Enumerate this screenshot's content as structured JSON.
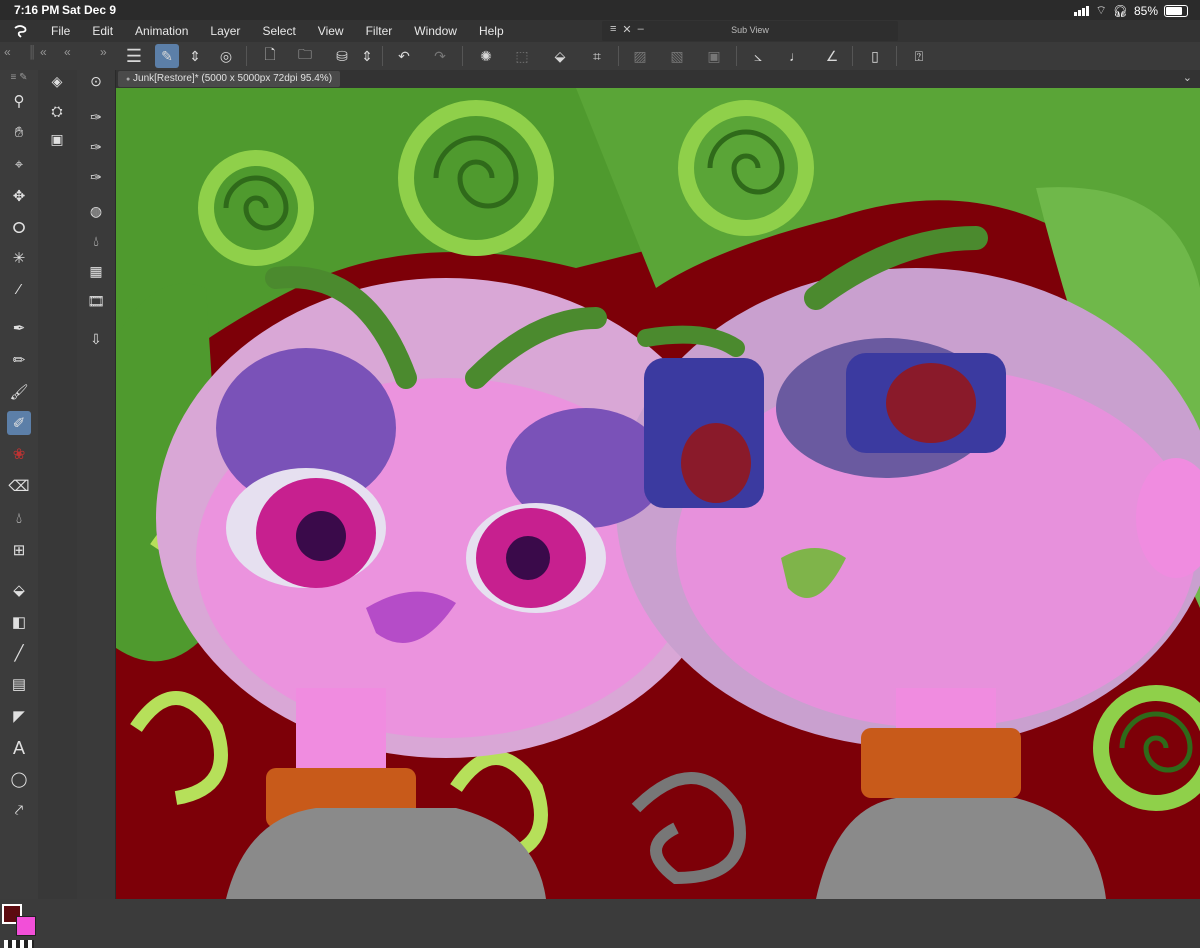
{
  "statusbar": {
    "time": "7:16 PM",
    "date": "Sat Dec 9",
    "battery": "85%"
  },
  "menu": [
    "File",
    "Edit",
    "Animation",
    "Layer",
    "Select",
    "View",
    "Filter",
    "Window",
    "Help"
  ],
  "subview": {
    "title": "Sub View"
  },
  "document": {
    "tab_label": "Junk[Restore]* (5000 x 5000px 72dpi 95.4%)"
  },
  "colors": {
    "main": "#5c0b10",
    "sub": "#f24fd8",
    "canvas_bg": "#7d0008",
    "hair": "#5aa537",
    "skin": "#f08ce0"
  }
}
